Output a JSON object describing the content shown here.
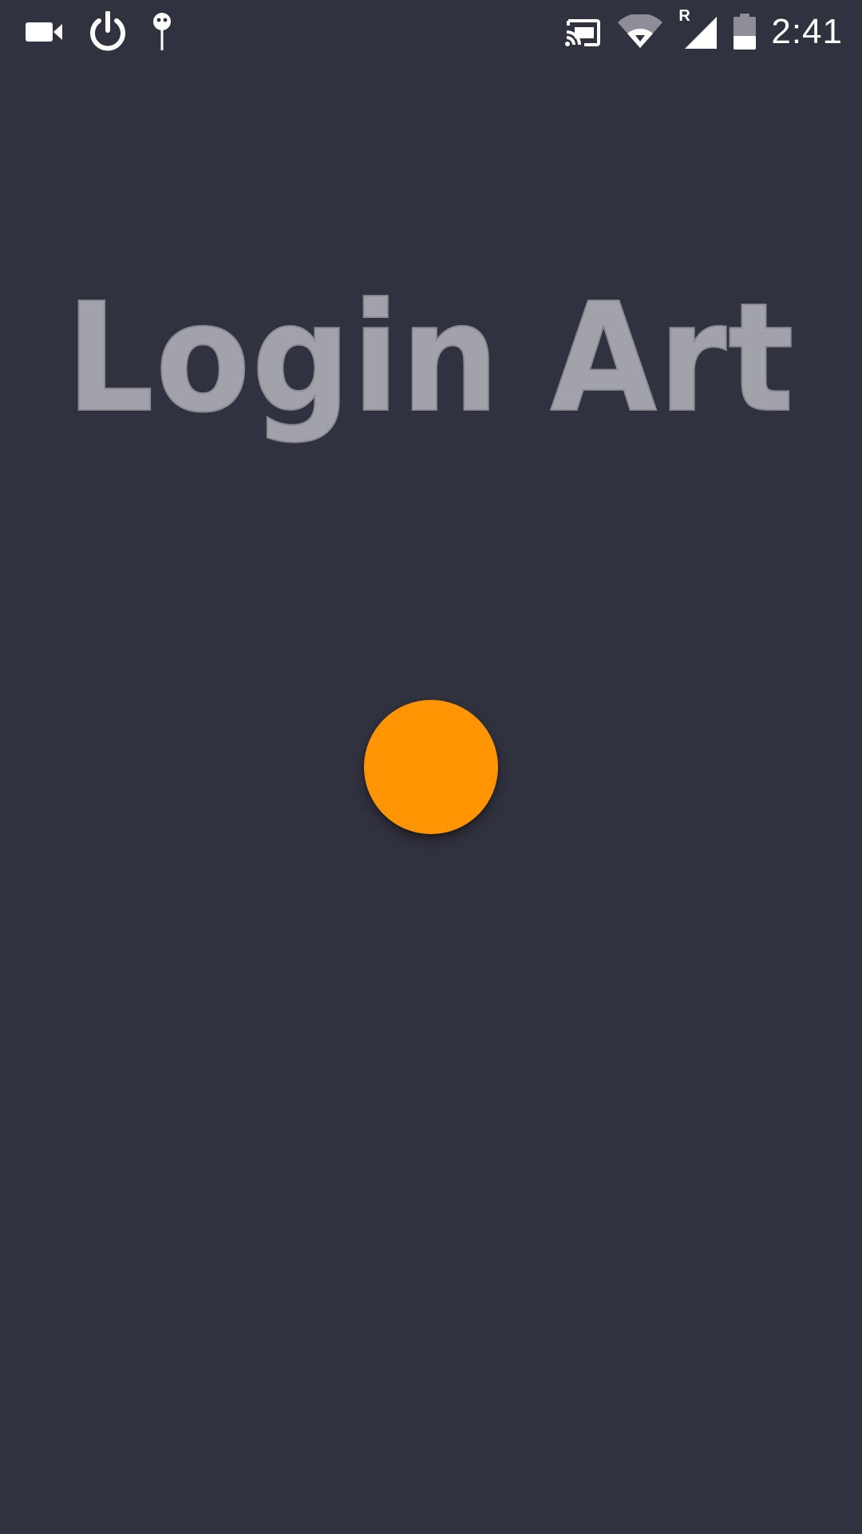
{
  "status_bar": {
    "time": "2:41",
    "roaming_label": "R",
    "left_icons": [
      "video-camera-icon",
      "power-icon",
      "pushpin-icon"
    ],
    "right_icons": [
      "cast-icon",
      "wifi-icon",
      "cell-signal-icon",
      "battery-icon"
    ]
  },
  "app": {
    "title": "Login Art",
    "colors": {
      "background": "#31323f",
      "title": "#a2a2ab",
      "accent": "#ff9502"
    }
  }
}
